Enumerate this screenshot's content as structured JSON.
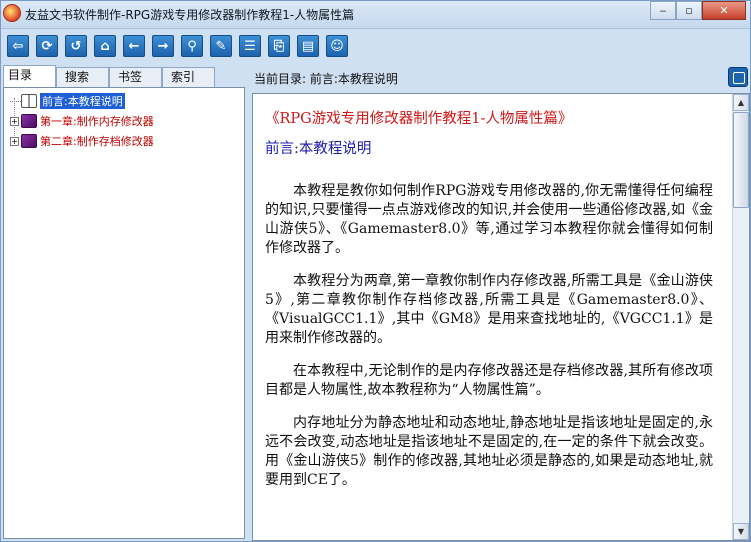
{
  "window": {
    "title": "友益文书软件制作-RPG游戏专用修改器制作教程1-人物属性篇",
    "controls": {
      "minimize": "‒",
      "maximize": "▫",
      "close": "✕"
    }
  },
  "toolbar": {
    "buttons": [
      {
        "name": "exit-icon",
        "glyph": "⇦"
      },
      {
        "name": "refresh-icon",
        "glyph": "⟳"
      },
      {
        "name": "reload-icon",
        "glyph": "↺"
      },
      {
        "name": "home-icon",
        "glyph": "⌂"
      },
      {
        "name": "back-icon",
        "glyph": "←"
      },
      {
        "name": "forward-icon",
        "glyph": "→"
      },
      {
        "name": "search-icon",
        "glyph": "⚲"
      },
      {
        "name": "eraser-icon",
        "glyph": "✎"
      },
      {
        "name": "notes-icon",
        "glyph": "☰"
      },
      {
        "name": "export-icon",
        "glyph": "⎘"
      },
      {
        "name": "bookmark-icon",
        "glyph": "▤"
      },
      {
        "name": "smiley-icon",
        "glyph": "☺"
      }
    ]
  },
  "sidebar": {
    "tabs": [
      {
        "label": "目录"
      },
      {
        "label": "搜索"
      },
      {
        "label": "书签"
      },
      {
        "label": "索引"
      }
    ],
    "tree": [
      {
        "label": "前言:本教程说明",
        "selected": true
      },
      {
        "label": "第一章:制作内存修改器",
        "selected": false
      },
      {
        "label": "第二章:制作存档修改器",
        "selected": false
      }
    ]
  },
  "content": {
    "path_label": "当前目录:",
    "path_value": "前言:本教程说明",
    "title": "《RPG游戏专用修改器制作教程1-人物属性篇》",
    "subtitle": "前言:本教程说明",
    "paragraphs": [
      "本教程是教你如何制作RPG游戏专用修改器的,你无需懂得任何编程的知识,只要懂得一点点游戏修改的知识,并会使用一些通俗修改器,如《金山游侠5》、《Gamemaster8.0》等,通过学习本教程你就会懂得如何制作修改器了。",
      "本教程分为两章,第一章教你制作内存修改器,所需工具是《金山游侠5》,第二章教你制作存档修改器,所需工具是《Gamemaster8.0》、《VisualGCC1.1》,其中《GM8》是用来查找地址的,《VGCC1.1》是用来制作修改器的。",
      "在本教程中,无论制作的是内存修改器还是存档修改器,其所有修改项目都是人物属性,故本教程称为“人物属性篇”。",
      "内存地址分为静态地址和动态地址,静态地址是指该地址是固定的,永远不会改变,动态地址是指该地址不是固定的,在一定的条件下就会改变。用《金山游侠5》制作的修改器,其地址必须是静态的,如果是动态地址,就要用到CE了。"
    ]
  }
}
